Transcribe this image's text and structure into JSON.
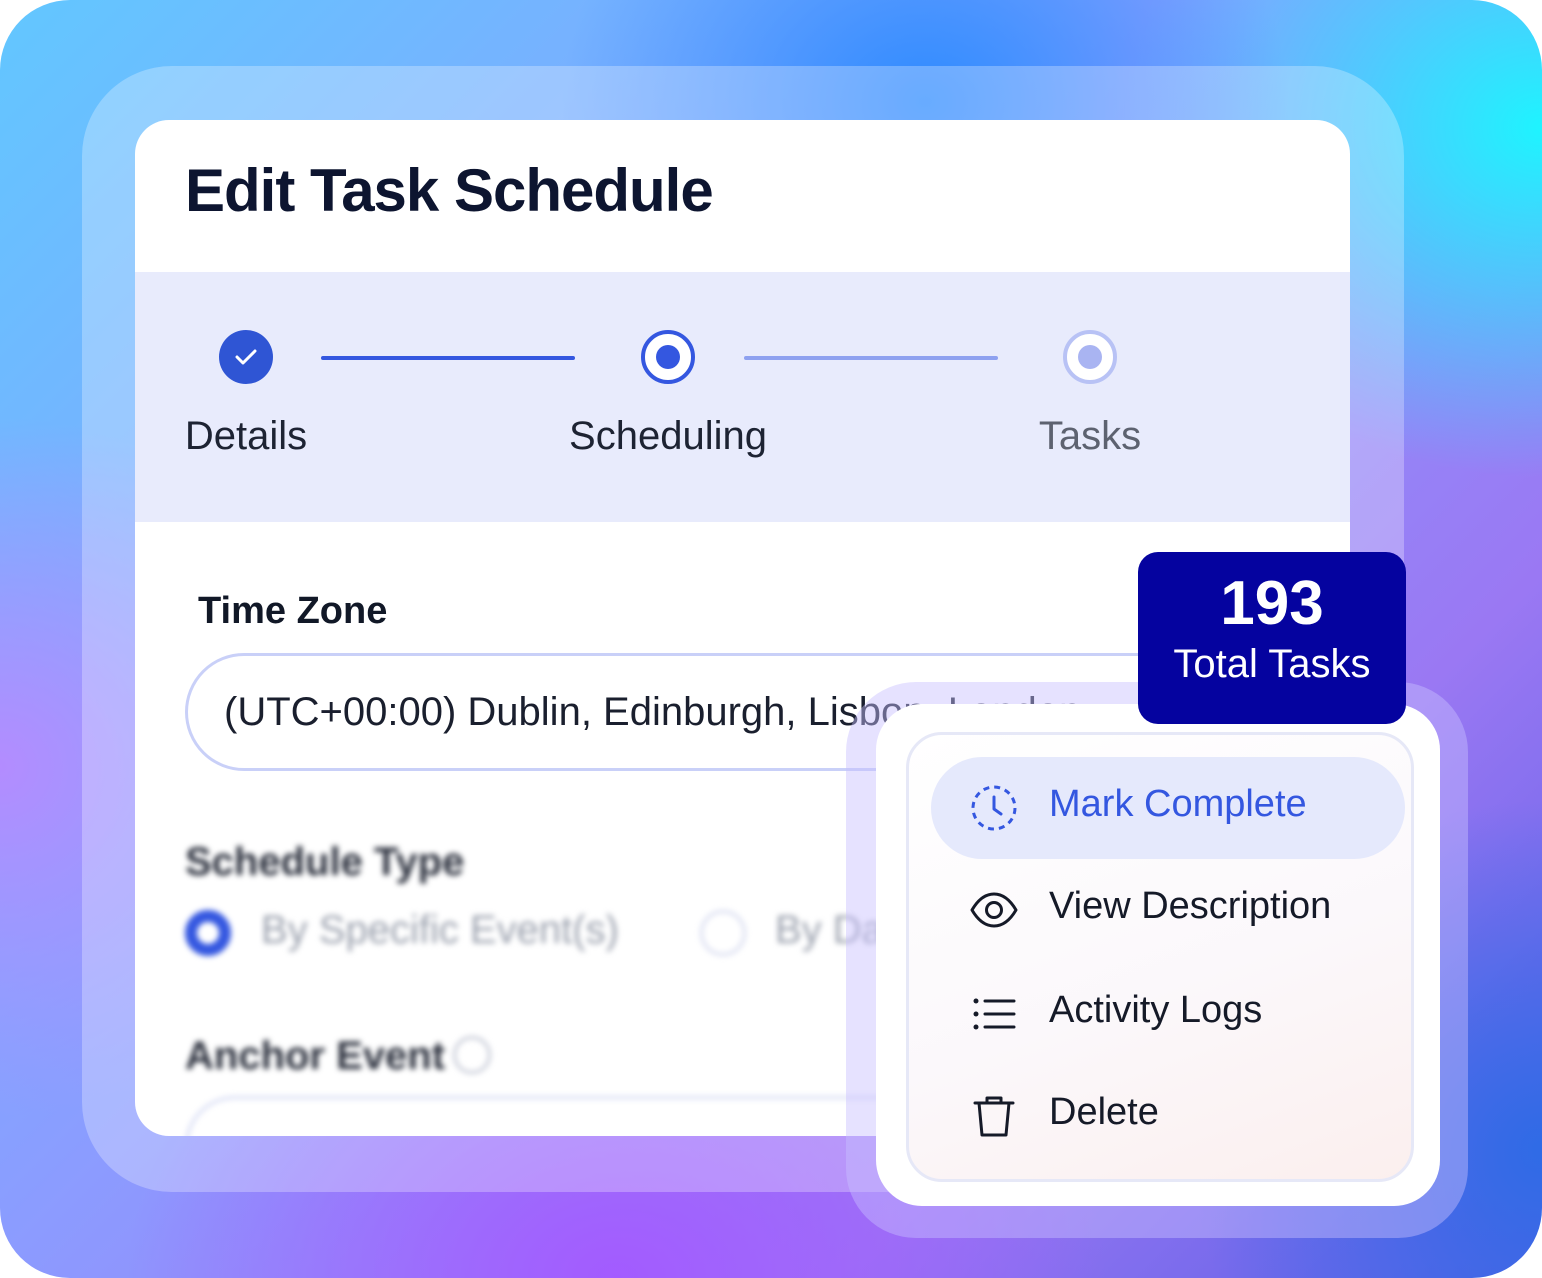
{
  "dialog": {
    "title": "Edit Task Schedule"
  },
  "stepper": {
    "steps": [
      {
        "label": "Details",
        "state": "complete"
      },
      {
        "label": "Scheduling",
        "state": "active"
      },
      {
        "label": "Tasks",
        "state": "pending"
      }
    ]
  },
  "form": {
    "time_zone_label": "Time Zone",
    "time_zone_value": "(UTC+00:00) Dublin, Edinburgh, Lisbon, London",
    "schedule_type_label": "Schedule Type",
    "schedule_options": [
      "By Specific Event(s)",
      "By Date"
    ],
    "anchor_event_label": "Anchor Event"
  },
  "badge": {
    "count": "193",
    "label": "Total Tasks"
  },
  "context_menu": {
    "items": [
      {
        "label": "Mark Complete",
        "icon": "clock-dashed-icon"
      },
      {
        "label": "View Description",
        "icon": "eye-icon"
      },
      {
        "label": "Activity Logs",
        "icon": "list-icon"
      },
      {
        "label": "Delete",
        "icon": "trash-icon"
      }
    ]
  },
  "colors": {
    "accent": "#3457e0",
    "badge_bg": "#05039f",
    "stepper_bg": "#e8ebfc"
  }
}
